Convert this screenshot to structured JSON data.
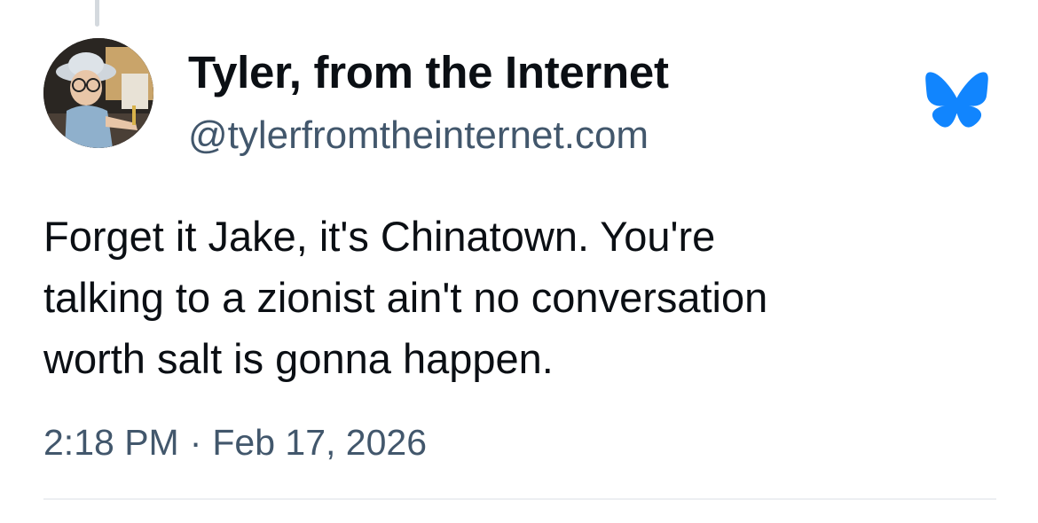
{
  "post": {
    "author": {
      "display_name": "Tyler, from the Internet",
      "handle": "@tylerfromtheinternet.com",
      "avatar_description_icon": "avatar-photo"
    },
    "platform_logo_icon": "bluesky-butterfly-icon",
    "platform_color": "#1185fe",
    "text_lines": [
      "Forget it Jake, it's Chinatown. You're",
      "talking to a zionist ain't no conversation",
      "worth salt is gonna happen."
    ],
    "time": "2:18 PM",
    "separator": "·",
    "date": "Feb 17, 2026"
  }
}
